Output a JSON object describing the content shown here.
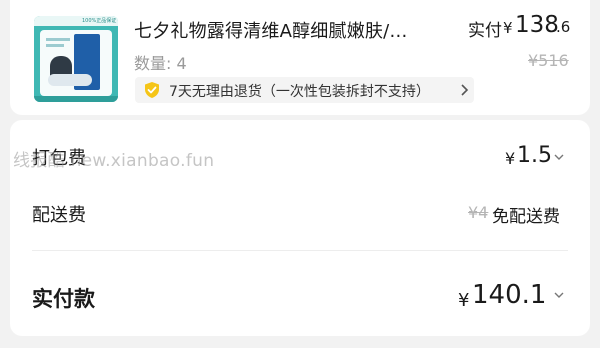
{
  "product": {
    "title": "七夕礼物露得清维A醇细腻嫩肤/…",
    "thumb_banner": "100%正品保证",
    "paid_label": "实付",
    "paid_currency": "¥",
    "paid_int": "138",
    "paid_dec": ".6",
    "quantity": "数量: 4",
    "original_price": "¥516",
    "return_policy": "7天无理由退货（一次性包装拆封不支持）"
  },
  "packing": {
    "label": "打包费",
    "currency": "¥",
    "value": "1.5"
  },
  "watermark": "线报酷 new.xianbao.fun",
  "shipping": {
    "label": "配送费",
    "original": "¥4",
    "free_label": "免配送费"
  },
  "total": {
    "label": "实付款",
    "currency": "¥",
    "value": "140.1"
  },
  "colors": {
    "brand_teal": "#3fb8b4",
    "shield_yellow": "#f5c518",
    "text_primary": "#1a1a1a",
    "text_muted": "#9a9a9a"
  },
  "icons": {
    "badge": "shield-check-icon",
    "badge_more": "chevron-right-icon",
    "packing_more": "chevron-down-icon",
    "total_more": "chevron-down-icon"
  }
}
